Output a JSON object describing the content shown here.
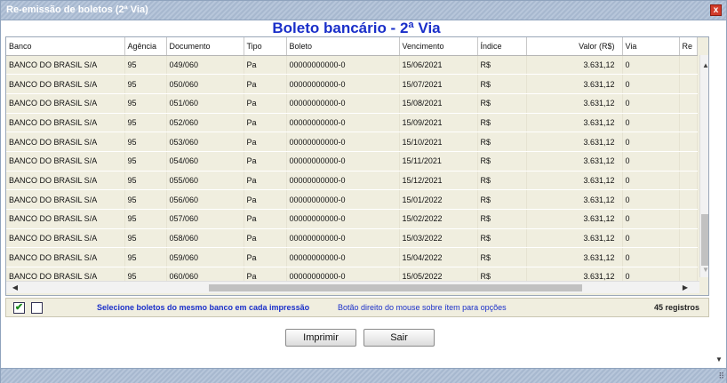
{
  "window": {
    "title": "Re-emissão de boletos (2ª Via)",
    "close_label": "x"
  },
  "heading": "Boleto bancário - 2ª Via",
  "table": {
    "columns": [
      "Banco",
      "Agência",
      "Documento",
      "Tipo",
      "Boleto",
      "Vencimento",
      "Índice",
      "Valor (R$)",
      "Via",
      "Re"
    ],
    "rows": [
      [
        "BANCO DO BRASIL S/A",
        "95",
        "049/060",
        "Pa",
        "00000000000-0",
        "15/06/2021",
        "R$",
        "3.631,12",
        "0",
        ""
      ],
      [
        "BANCO DO BRASIL S/A",
        "95",
        "050/060",
        "Pa",
        "00000000000-0",
        "15/07/2021",
        "R$",
        "3.631,12",
        "0",
        ""
      ],
      [
        "BANCO DO BRASIL S/A",
        "95",
        "051/060",
        "Pa",
        "00000000000-0",
        "15/08/2021",
        "R$",
        "3.631,12",
        "0",
        ""
      ],
      [
        "BANCO DO BRASIL S/A",
        "95",
        "052/060",
        "Pa",
        "00000000000-0",
        "15/09/2021",
        "R$",
        "3.631,12",
        "0",
        ""
      ],
      [
        "BANCO DO BRASIL S/A",
        "95",
        "053/060",
        "Pa",
        "00000000000-0",
        "15/10/2021",
        "R$",
        "3.631,12",
        "0",
        ""
      ],
      [
        "BANCO DO BRASIL S/A",
        "95",
        "054/060",
        "Pa",
        "00000000000-0",
        "15/11/2021",
        "R$",
        "3.631,12",
        "0",
        ""
      ],
      [
        "BANCO DO BRASIL S/A",
        "95",
        "055/060",
        "Pa",
        "00000000000-0",
        "15/12/2021",
        "R$",
        "3.631,12",
        "0",
        ""
      ],
      [
        "BANCO DO BRASIL S/A",
        "95",
        "056/060",
        "Pa",
        "00000000000-0",
        "15/01/2022",
        "R$",
        "3.631,12",
        "0",
        ""
      ],
      [
        "BANCO DO BRASIL S/A",
        "95",
        "057/060",
        "Pa",
        "00000000000-0",
        "15/02/2022",
        "R$",
        "3.631,12",
        "0",
        ""
      ],
      [
        "BANCO DO BRASIL S/A",
        "95",
        "058/060",
        "Pa",
        "00000000000-0",
        "15/03/2022",
        "R$",
        "3.631,12",
        "0",
        ""
      ],
      [
        "BANCO DO BRASIL S/A",
        "95",
        "059/060",
        "Pa",
        "00000000000-0",
        "15/04/2022",
        "R$",
        "3.631,12",
        "0",
        ""
      ],
      [
        "BANCO DO BRASIL S/A",
        "95",
        "060/060",
        "Pa",
        "00000000000-0",
        "15/05/2022",
        "R$",
        "3.631,12",
        "0",
        ""
      ]
    ]
  },
  "footer": {
    "hint_same_bank": "Selecione boletos do mesmo banco em cada impressão",
    "hint_right_click": "Botão direito do mouse sobre ítem para opções",
    "record_count": "45 registros",
    "select_all_checked": true,
    "select_none_checked": false
  },
  "buttons": {
    "print": "Imprimir",
    "exit": "Sair"
  },
  "icons": {
    "close": "close-icon",
    "scroll_up": "arrow-up-icon",
    "scroll_down": "arrow-down-icon",
    "scroll_left": "arrow-left-icon",
    "scroll_right": "arrow-right-icon",
    "check": "checkmark-icon",
    "resize": "resize-grip-icon"
  },
  "colors": {
    "heading": "#1a2fc9",
    "grid_background": "#f0eedf",
    "titlebar": "#a7b8cf",
    "close_button": "#d23b2a"
  }
}
